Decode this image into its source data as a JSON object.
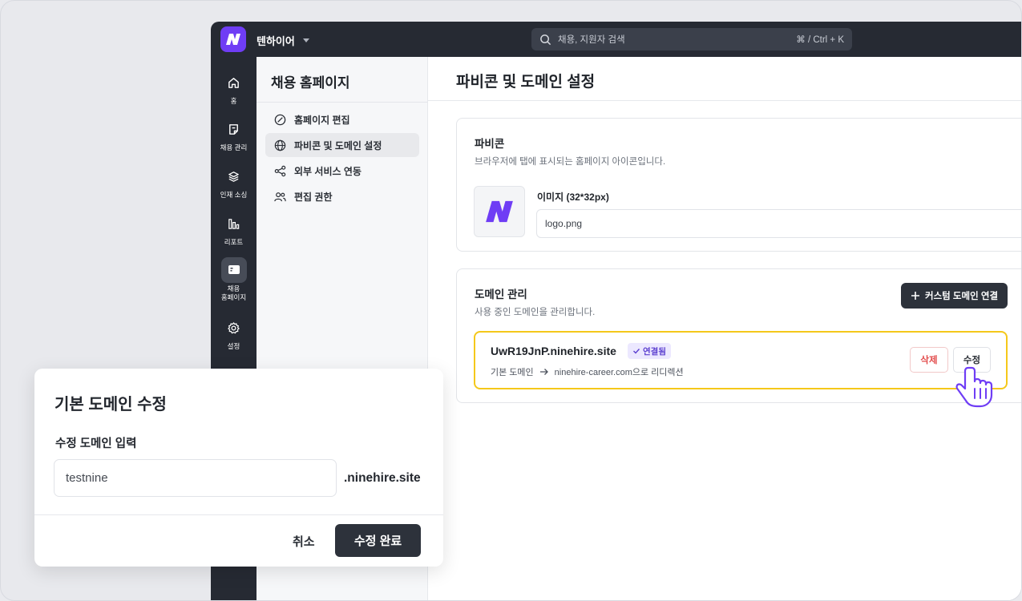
{
  "topbar": {
    "workspace": "텐하이어",
    "search_placeholder": "채용, 지원자 검색",
    "search_shortcut": "⌘ / Ctrl + K"
  },
  "rail": {
    "items": [
      {
        "label": "홈",
        "icon": "home-icon"
      },
      {
        "label": "채용 관리",
        "icon": "document-icon"
      },
      {
        "label": "인재 소싱",
        "icon": "layers-icon"
      },
      {
        "label": "리포트",
        "icon": "bar-chart-icon"
      },
      {
        "label": "채용\n홈페이지",
        "icon": "monitor-icon",
        "active": true
      },
      {
        "label": "설정",
        "icon": "gear-icon"
      }
    ]
  },
  "panel": {
    "title": "채용 홈페이지",
    "items": [
      {
        "label": "홈페이지 편집",
        "icon": "edit-dial-icon"
      },
      {
        "label": "파비콘 및 도메인 설정",
        "icon": "globe-icon",
        "active": true
      },
      {
        "label": "외부 서비스 연동",
        "icon": "share-icon"
      },
      {
        "label": "편집 권한",
        "icon": "users-icon"
      }
    ]
  },
  "main": {
    "title": "파비콘 및 도메인 설정",
    "favicon": {
      "title": "파비콘",
      "desc": "브라우저에 탭에 표시되는 홈페이지 아이콘입니다.",
      "image_label": "이미지 (32*32px)",
      "file_name": "logo.png"
    },
    "domain": {
      "title": "도메인 관리",
      "desc": "사용 중인 도메인을 관리합니다.",
      "add_button": "커스텀 도메인 연결",
      "entry": {
        "name": "UwR19JnP.ninehire.site",
        "status": "연결됨",
        "redirect_from": "기본 도메인",
        "redirect_to": "ninehire-career.com으로 리디렉션",
        "delete_label": "삭제",
        "edit_label": "수정"
      }
    }
  },
  "modal": {
    "title": "기본 도메인 수정",
    "field_label": "수정 도메인 입력",
    "input_value": "testnine",
    "suffix": ".ninehire.site",
    "cancel_label": "취소",
    "confirm_label": "수정 완료"
  },
  "colors": {
    "brand": "#6f3df5",
    "dark": "#262a33",
    "highlight": "#f5c81a",
    "danger": "#e24b4b"
  }
}
